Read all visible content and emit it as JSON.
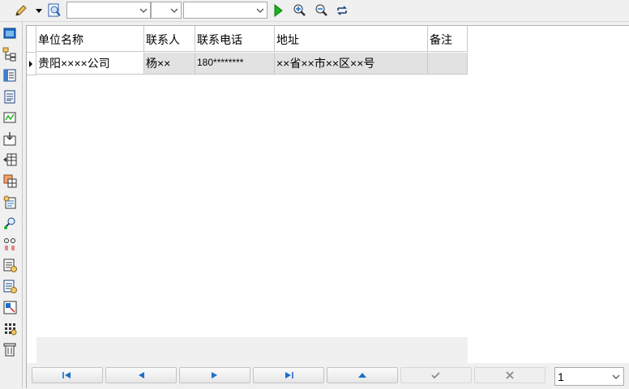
{
  "toolbar": {
    "combo1_value": "",
    "combo2_value": "",
    "combo3_value": ""
  },
  "grid": {
    "columns": [
      "单位名称",
      "联系人",
      "联系电话",
      "地址",
      "备注"
    ],
    "rows": [
      [
        "贵阳××××公司",
        "杨××",
        "180********",
        "××省××市××区××号",
        ""
      ]
    ]
  },
  "pager": {
    "page": "1"
  },
  "colors": {
    "accent": "#1a6fc9",
    "run": "#1bb41b"
  }
}
